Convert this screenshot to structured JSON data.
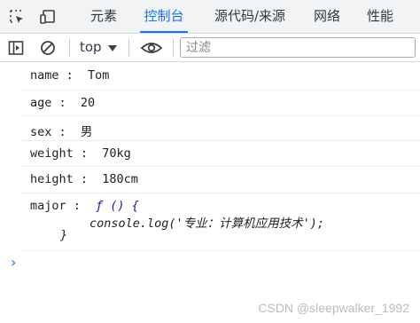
{
  "tabs": [
    {
      "label": "元素",
      "active": false
    },
    {
      "label": "控制台",
      "active": true
    },
    {
      "label": "源代码/来源",
      "active": false
    },
    {
      "label": "网络",
      "active": false
    },
    {
      "label": "性能",
      "active": false
    }
  ],
  "toolbar": {
    "context": "top",
    "filter_placeholder": "过滤"
  },
  "console": {
    "rows": [
      {
        "key": "name",
        "value": "Tom"
      },
      {
        "key": "age",
        "value": "20"
      },
      {
        "key": "sex",
        "value": "男"
      },
      {
        "key": "weight",
        "value": "70kg"
      },
      {
        "key": "height",
        "value": "180cm"
      }
    ],
    "major": {
      "key": "major",
      "fn_head": "ƒ () {",
      "fn_body": "console.log('专业：计算机应用技术');",
      "fn_close": "}"
    },
    "prompt": "›"
  },
  "watermark": "CSDN @sleepwalker_1992",
  "colors": {
    "accent": "#1a73e8",
    "tabbar_bg": "#f1f3f4"
  }
}
